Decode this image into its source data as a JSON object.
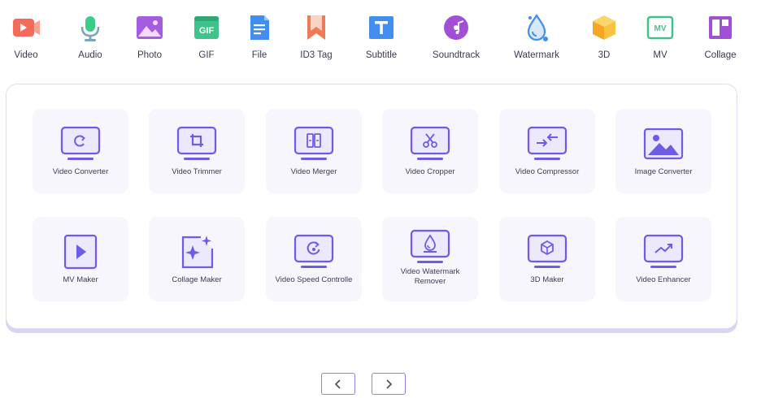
{
  "nav": {
    "items": [
      {
        "label": "Video",
        "icon": "video-icon",
        "color": "#f26b5b"
      },
      {
        "label": "Audio",
        "icon": "microphone-icon",
        "color": "#3ecb8a"
      },
      {
        "label": "Photo",
        "icon": "photo-icon",
        "color": "#a45de0"
      },
      {
        "label": "GIF",
        "icon": "gif-icon",
        "color": "#3ec48a"
      },
      {
        "label": "File",
        "icon": "file-icon",
        "color": "#3f8ef0"
      },
      {
        "label": "ID3 Tag",
        "icon": "bookmark-icon",
        "color": "#f07a56"
      },
      {
        "label": "Subtitle",
        "icon": "subtitle-icon",
        "color": "#3f8ef0"
      },
      {
        "label": "Soundtrack",
        "icon": "soundtrack-icon",
        "color": "#a24fd8"
      },
      {
        "label": "Watermark",
        "icon": "water-drop-icon",
        "color": "#3f8ef0"
      },
      {
        "label": "3D",
        "icon": "cube-icon",
        "color": "#f5c340"
      },
      {
        "label": "MV",
        "icon": "mv-icon",
        "color": "#3ec48a"
      },
      {
        "label": "Collage",
        "icon": "collage-icon",
        "color": "#a24fd8"
      }
    ]
  },
  "tools": {
    "row1": [
      {
        "label": "Video Converter",
        "icon": "video-converter-icon"
      },
      {
        "label": "Video Trimmer",
        "icon": "video-trimmer-icon"
      },
      {
        "label": "Video Merger",
        "icon": "video-merger-icon"
      },
      {
        "label": "Video Cropper",
        "icon": "video-cropper-icon"
      },
      {
        "label": "Video Compressor",
        "icon": "video-compressor-icon"
      },
      {
        "label": "Image Converter",
        "icon": "image-converter-icon"
      }
    ],
    "row2": [
      {
        "label": "MV Maker",
        "icon": "mv-maker-icon"
      },
      {
        "label": "Collage Maker",
        "icon": "collage-maker-icon"
      },
      {
        "label": "Video Speed Controlle",
        "icon": "speed-controller-icon"
      },
      {
        "label": "Video Watermark Remover",
        "icon": "watermark-remover-icon"
      },
      {
        "label": "3D Maker",
        "icon": "3d-maker-icon"
      },
      {
        "label": "Video Enhancer",
        "icon": "video-enhancer-icon"
      }
    ]
  },
  "pager": {
    "prev_icon": "chevron-left-icon",
    "next_icon": "chevron-right-icon"
  },
  "colors": {
    "accent": "#6c5ce7",
    "icon_fill": "#ece9fd",
    "card_bg": "#f7f6fd"
  }
}
